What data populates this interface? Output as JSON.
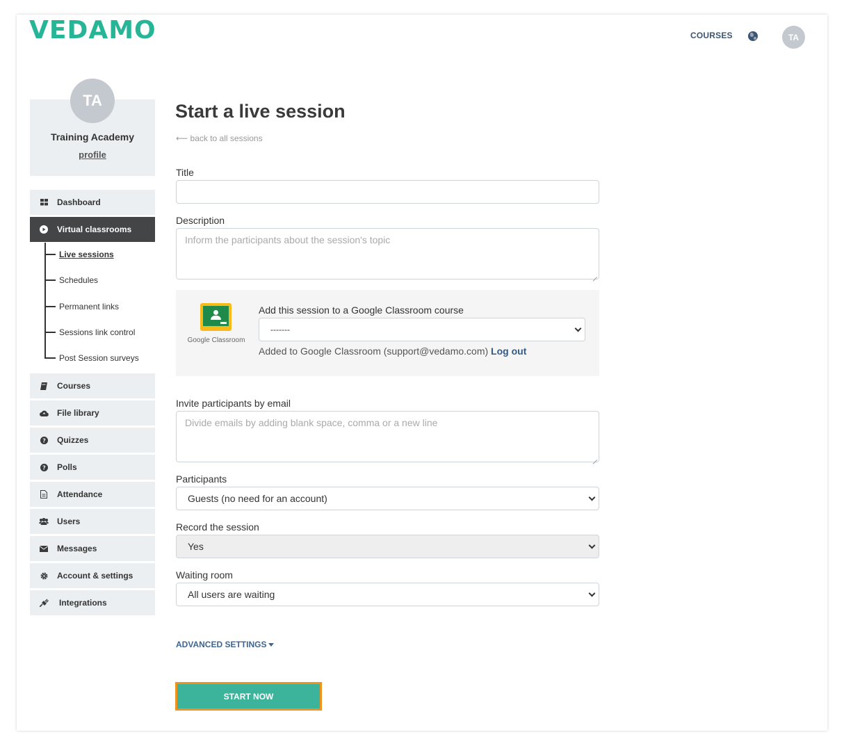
{
  "header": {
    "logo": "VEDAMO",
    "nav_courses": "COURSES",
    "globe_icon": "globe-icon",
    "avatar_initials": "TA"
  },
  "sidebar": {
    "profile": {
      "initials": "TA",
      "name": "Training Academy",
      "link": "profile"
    },
    "items": [
      {
        "label": "Dashboard",
        "icon": "dashboard-icon"
      },
      {
        "label": "Virtual classrooms",
        "icon": "play-circle-icon",
        "active": true
      },
      {
        "label": "Courses",
        "icon": "book-icon"
      },
      {
        "label": "File library",
        "icon": "cloud-upload-icon"
      },
      {
        "label": "Quizzes",
        "icon": "question-circle-icon"
      },
      {
        "label": "Polls",
        "icon": "question-circle-icon"
      },
      {
        "label": "Attendance",
        "icon": "document-icon"
      },
      {
        "label": "Users",
        "icon": "users-icon"
      },
      {
        "label": "Messages",
        "icon": "envelope-icon"
      },
      {
        "label": "Account & settings",
        "icon": "gear-icon"
      },
      {
        "label": "Integrations",
        "icon": "plug-icon"
      }
    ],
    "sub_items": [
      {
        "label": "Live sessions",
        "current": true
      },
      {
        "label": "Schedules"
      },
      {
        "label": "Permanent links"
      },
      {
        "label": "Sessions link control"
      },
      {
        "label": "Post Session surveys"
      }
    ]
  },
  "main": {
    "title": "Start a live session",
    "back_link": "⟵ back to all sessions",
    "title_label": "Title",
    "title_value": "",
    "description_label": "Description",
    "description_placeholder": "Inform the participants about the session's topic",
    "google_classroom": {
      "logo_text": "Google Classroom",
      "label": "Add this session to a Google Classroom course",
      "selected": "-------",
      "status": "Added to Google Classroom (support@vedamo.com)",
      "logout": "Log out"
    },
    "invite_label": "Invite participants by email",
    "invite_placeholder": "Divide emails by adding blank space, comma or a new line",
    "participants_label": "Participants",
    "participants_value": "Guests (no need for an account)",
    "record_label": "Record the session",
    "record_value": "Yes",
    "waiting_label": "Waiting room",
    "waiting_value": "All users are waiting",
    "advanced": "ADVANCED SETTINGS",
    "start_button": "START NOW"
  },
  "colors": {
    "brand_green": "#27b597",
    "button_green": "#3cb49b",
    "highlight_orange": "#f0921e",
    "nav_blue": "#3d5472",
    "sidebar_active": "#444547"
  }
}
